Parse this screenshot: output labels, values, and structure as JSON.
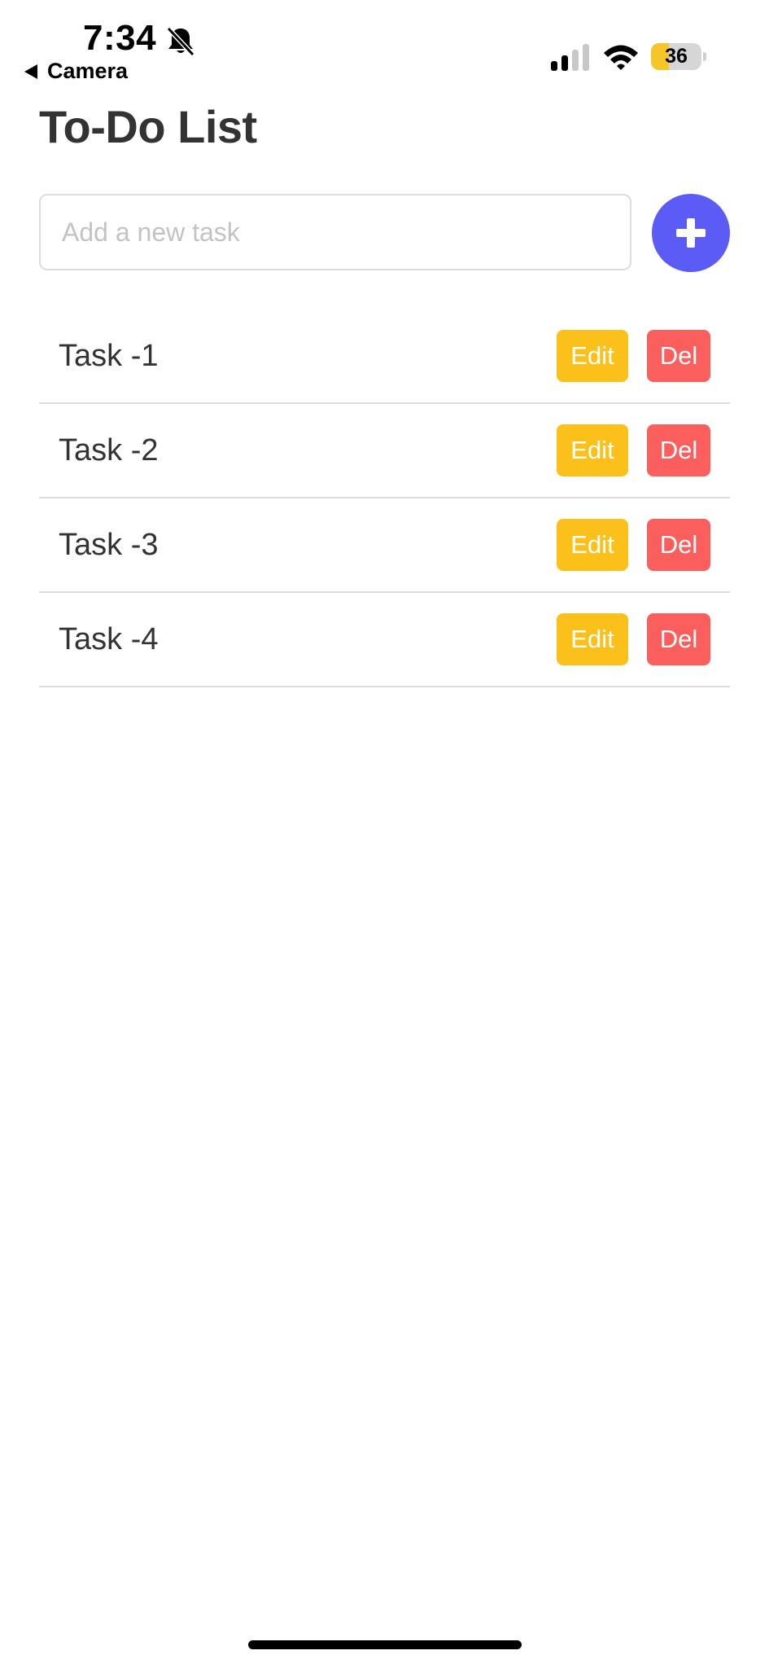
{
  "status_bar": {
    "time": "7:34",
    "back_label": "Camera",
    "battery_level": "36",
    "battery_fraction": 0.36,
    "icons": [
      "bell-slash-icon",
      "cellular-signal-icon",
      "wifi-icon",
      "battery-icon"
    ]
  },
  "header": {
    "title": "To-Do List"
  },
  "input": {
    "placeholder": "Add a new task",
    "value": "",
    "add_icon": "plus-icon"
  },
  "tasks": [
    {
      "text": "Task -1",
      "edit_label": "Edit",
      "delete_label": "Del"
    },
    {
      "text": "Task -2",
      "edit_label": "Edit",
      "delete_label": "Del"
    },
    {
      "text": "Task -3",
      "edit_label": "Edit",
      "delete_label": "Del"
    },
    {
      "text": "Task -4",
      "edit_label": "Edit",
      "delete_label": "Del"
    }
  ],
  "colors": {
    "accent": "#5b5bf6",
    "edit": "#fbc11a",
    "delete": "#fa5f5d",
    "text": "#333333",
    "divider": "#dcdcdc",
    "battery": "#f6c628"
  }
}
